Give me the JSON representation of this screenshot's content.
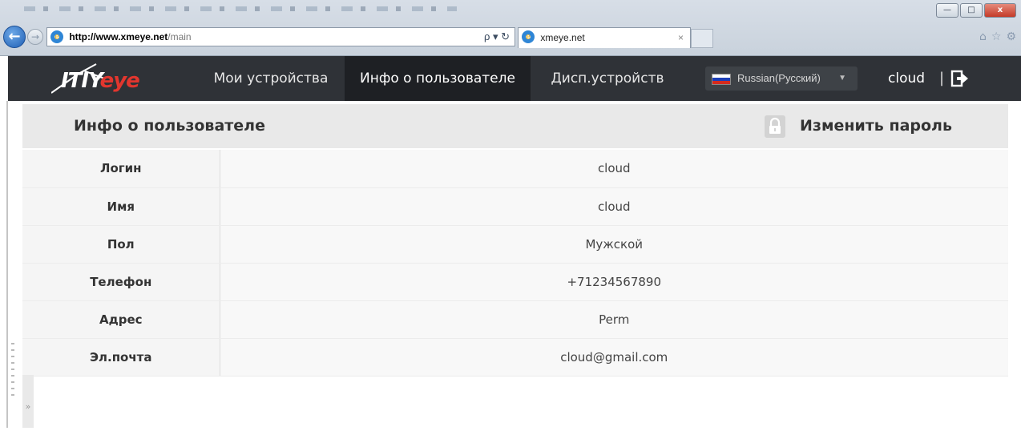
{
  "browser": {
    "url_domain": "http://www.xmeye.net",
    "url_path": "/main",
    "search_glyph": "ρ",
    "tab_title": "xmeye.net",
    "window_buttons": [
      "—",
      "□",
      "x"
    ]
  },
  "navbar": {
    "logo_part1": "ITIY",
    "logo_part2": "eye",
    "items": [
      "Мои устройства",
      "Инфо о пользователе",
      "Дисп.устройств"
    ],
    "active_index": 1,
    "language": "Russian(Русский)",
    "username": "cloud",
    "separator": "|"
  },
  "panel": {
    "title": "Инфо о пользователе",
    "change_password": "Изменить пароль"
  },
  "user_info": [
    {
      "label": "Логин",
      "value": "cloud"
    },
    {
      "label": "Имя",
      "value": "cloud"
    },
    {
      "label": "Пол",
      "value": "Мужской"
    },
    {
      "label": "Телефон",
      "value": "+71234567890"
    },
    {
      "label": "Адрес",
      "value": "Perm"
    },
    {
      "label": "Эл.почта",
      "value": "cloud@gmail.com"
    }
  ],
  "colors": {
    "navbar_bg": "#2f3237",
    "navbar_active_bg": "#1e2024",
    "logo_accent": "#e2362e"
  },
  "icons": [
    "back-arrow-icon",
    "forward-arrow-icon",
    "ie-icon",
    "refresh-icon",
    "home-icon",
    "star-icon",
    "gear-icon",
    "flag-icon",
    "caret-down-icon",
    "logout-icon",
    "lock-icon"
  ]
}
